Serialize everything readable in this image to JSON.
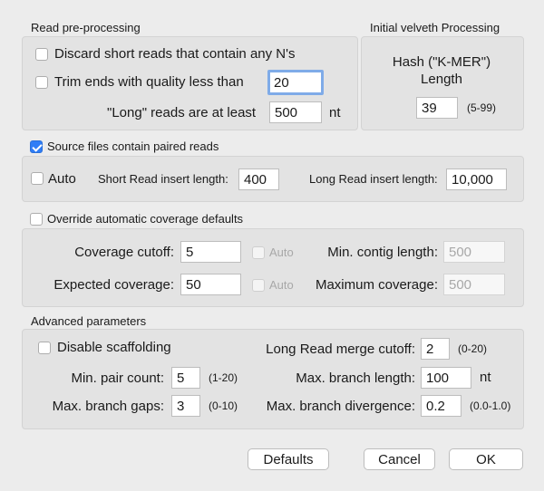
{
  "read_preprocessing": {
    "title": "Read pre-processing",
    "discard_label": "Discard short reads that contain any N's",
    "trim_label": "Trim ends with quality less than",
    "trim_value": "20",
    "long_label": "\"Long\" reads are at least",
    "long_value": "500",
    "long_unit": "nt"
  },
  "velveth": {
    "title": "Initial velveth Processing",
    "hash_label_1": "Hash (\"K-MER\")",
    "hash_label_2": "Length",
    "hash_value": "39",
    "hash_range": "(5-99)"
  },
  "paired": {
    "title": "Source files contain paired reads",
    "checked": true,
    "auto_label": "Auto",
    "short_insert_label": "Short Read insert length:",
    "short_insert_value": "400",
    "long_insert_label": "Long Read insert length:",
    "long_insert_value": "10,000"
  },
  "coverage": {
    "title": "Override automatic coverage defaults",
    "cutoff_label": "Coverage cutoff:",
    "cutoff_value": "5",
    "auto1": "Auto",
    "min_contig_label": "Min. contig length:",
    "min_contig_value": "500",
    "expected_label": "Expected coverage:",
    "expected_value": "50",
    "auto2": "Auto",
    "max_cov_label": "Maximum coverage:",
    "max_cov_value": "500"
  },
  "advanced": {
    "title": "Advanced parameters",
    "disable_scaffolding": "Disable scaffolding",
    "merge_label": "Long Read merge cutoff:",
    "merge_value": "2",
    "merge_range": "(0-20)",
    "min_pair_label": "Min. pair count:",
    "min_pair_value": "5",
    "min_pair_range": "(1-20)",
    "max_branch_len_label": "Max. branch length:",
    "max_branch_len_value": "100",
    "max_branch_len_unit": "nt",
    "max_gaps_label": "Max. branch gaps:",
    "max_gaps_value": "3",
    "max_gaps_range": "(0-10)",
    "max_div_label": "Max. branch divergence:",
    "max_div_value": "0.2",
    "max_div_range": "(0.0-1.0)"
  },
  "buttons": {
    "defaults": "Defaults",
    "cancel": "Cancel",
    "ok": "OK"
  }
}
